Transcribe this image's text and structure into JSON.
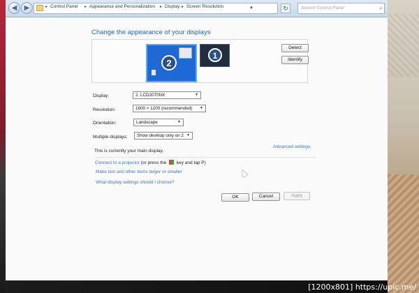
{
  "addressbar": {
    "crumbs": [
      "Control Panel",
      "Appearance and Personalization",
      "Display",
      "Screen Resolution"
    ],
    "search_placeholder": "Search Control Panel"
  },
  "page": {
    "heading": "Change the appearance of your displays",
    "detect_label": "Detect",
    "identify_label": "Identify",
    "monitors": [
      {
        "number": "2"
      },
      {
        "number": "1"
      }
    ]
  },
  "settings": {
    "display_label": "Display:",
    "display_value": "2. LCD2070NX",
    "resolution_label": "Resolution:",
    "resolution_value": "1600 × 1200 (recommended)",
    "orientation_label": "Orientation:",
    "orientation_value": "Landscape",
    "multiple_label": "Multiple displays:",
    "multiple_value": "Show desktop only on 2"
  },
  "info": {
    "main_display_text": "This is currently your main display.",
    "advanced_link": "Advanced settings",
    "projector_link": "Connect to a projector",
    "projector_rest_a": " (or press the ",
    "projector_rest_b": " key and tap P)",
    "text_size_link": "Make text and other items larger or smaller",
    "help_link": "What display settings should I choose?"
  },
  "buttons": {
    "ok": "OK",
    "cancel": "Cancel",
    "apply": "Apply"
  },
  "watermark": "[1200x801] https://upic.me/",
  "colors": {
    "accent": "#2a66b4",
    "link": "#3a77c4",
    "selected_monitor": "#1f69d6"
  }
}
